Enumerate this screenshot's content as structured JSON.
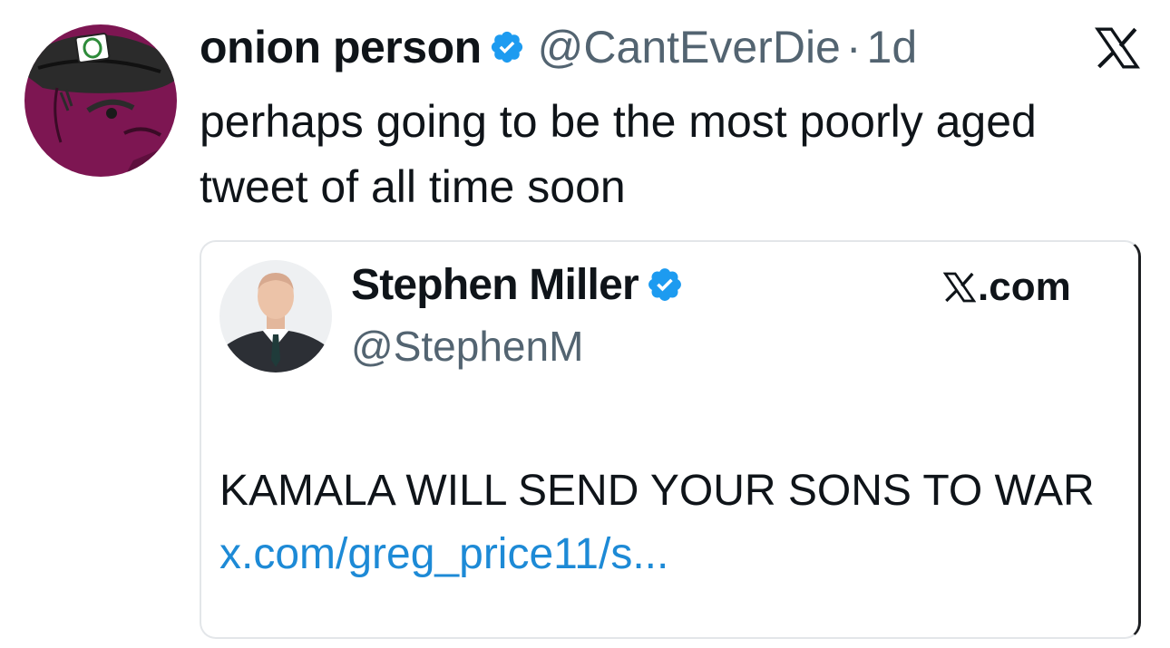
{
  "tweet": {
    "author_name": "onion person",
    "author_handle": "@CantEverDie",
    "separator": "·",
    "time": "1d",
    "text": "perhaps going to be the most poorly aged tweet of all time soon",
    "avatar_icon": "onion-avatar-icon",
    "verified_icon": "verified-badge-icon",
    "platform_icon": "x-logo-icon"
  },
  "quoted": {
    "author_name": "Stephen Miller",
    "author_handle": "@StephenM",
    "source": ".com",
    "source_icon": "x-logo-icon",
    "text": "KAMALA WILL SEND YOUR SONS TO WAR",
    "link": "x.com/greg_price11/s..."
  },
  "colors": {
    "verified": "#1d9bf0",
    "link": "#1d8ad6",
    "secondary_text": "#536471",
    "avatar_bg": "#7d1652"
  }
}
